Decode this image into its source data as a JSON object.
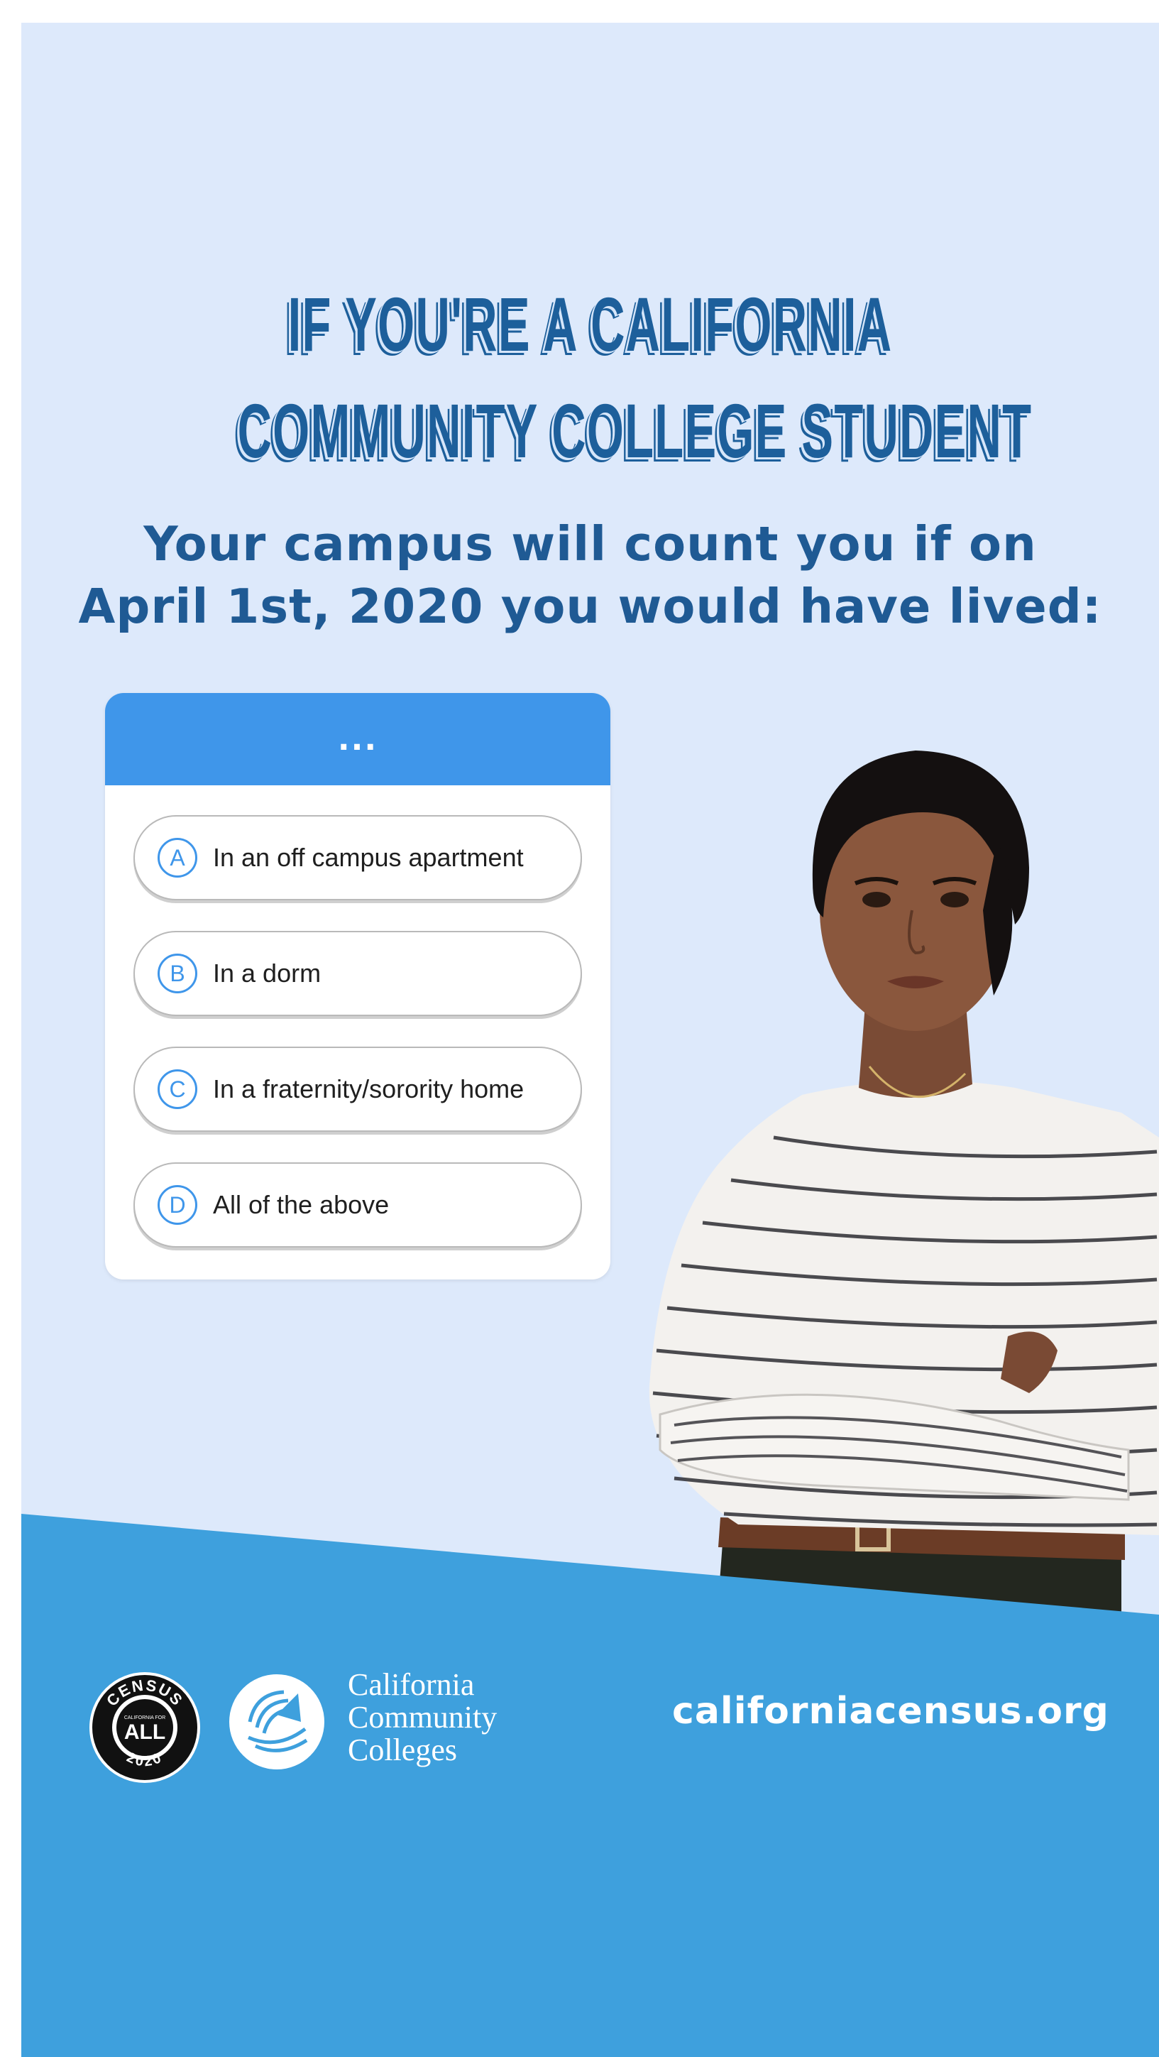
{
  "headline": {
    "line1": "IF YOU'RE A CALIFORNIA",
    "line2": "COMMUNITY COLLEGE STUDENT"
  },
  "subhead": {
    "line1": "Your campus will count you if on",
    "line2": "April 1st, 2020 you would have lived:"
  },
  "quiz": {
    "header": "...",
    "options": [
      {
        "letter": "A",
        "text": "In an off campus apartment"
      },
      {
        "letter": "B",
        "text": "In a dorm"
      },
      {
        "letter": "C",
        "text": "In a fraternity/sorority home"
      },
      {
        "letter": "D",
        "text": "All of the above"
      }
    ]
  },
  "census_logo": {
    "top": "CENSUS",
    "middle": "CALIFORNIA FOR",
    "center": "ALL",
    "bottom": "2020"
  },
  "college": {
    "line1": "California",
    "line2": "Community",
    "line3": "Colleges"
  },
  "website": "californiacensus.org",
  "colors": {
    "background": "#dde9fb",
    "headline": "#1d5f9b",
    "quiz_accent": "#3f96ea",
    "footer": "#3ea0dd"
  }
}
